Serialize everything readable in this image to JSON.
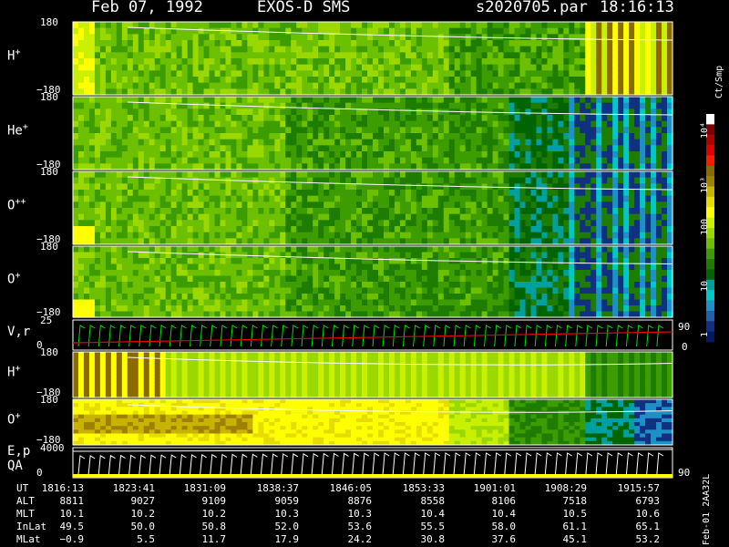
{
  "header": {
    "date": "Feb 07, 1992",
    "instrument": "EXOS-D SMS",
    "file": "s2020705.par",
    "time": "18:16:13"
  },
  "panels": [
    {
      "label_main": "H",
      "label_sup": "+",
      "top_tick": "180",
      "bottom_tick": "−180",
      "kind": "h_plus"
    },
    {
      "label_main": "He",
      "label_sup": "+",
      "top_tick": "180",
      "bottom_tick": "−180",
      "kind": "he_plus"
    },
    {
      "label_main": "O",
      "label_sup": "++",
      "top_tick": "180",
      "bottom_tick": "−180",
      "kind": "o_pp"
    },
    {
      "label_main": "O",
      "label_sup": "+",
      "top_tick": "180",
      "bottom_tick": "−180",
      "kind": "o_plus"
    },
    {
      "label_main": "V,r",
      "label_sup": "",
      "top_tick": "25",
      "bottom_tick": "0",
      "kind": "vr",
      "right_top": "90",
      "right_bottom": "0"
    },
    {
      "label_main": "H",
      "label_sup": "+",
      "top_tick": "180",
      "bottom_tick": "−180",
      "kind": "h_plus2"
    },
    {
      "label_main": "O",
      "label_sup": "+",
      "top_tick": "180",
      "bottom_tick": "−180",
      "kind": "o_plus2"
    },
    {
      "label_main": "E,p",
      "label_sub2": "QA",
      "label_sup": "",
      "top_tick": "4000",
      "bottom_tick": "0",
      "kind": "ep",
      "right_top": "90"
    }
  ],
  "colorbar": {
    "title": "Ct/Smp",
    "ticks": [
      "10⁴",
      "10³",
      "100",
      "10",
      "1"
    ],
    "colors": [
      "#ffffff",
      "#7f0000",
      "#b20000",
      "#e00000",
      "#ff1a00",
      "#8b6b00",
      "#a08000",
      "#c8b400",
      "#e6dc00",
      "#ffff00",
      "#c8f000",
      "#9ad800",
      "#6cc000",
      "#3c9c00",
      "#1e7d00",
      "#006400",
      "#00a0a0",
      "#00c8c8",
      "#1e90c8",
      "#2060b0",
      "#103080",
      "#001a60"
    ]
  },
  "chart_data": {
    "type": "heatmap",
    "title": "Feb 07, 1992   EXOS-D SMS",
    "x_axis_label": "UT",
    "ut_ticks": [
      "1816:13",
      "1823:41",
      "1831:09",
      "1838:37",
      "1846:05",
      "1853:33",
      "1901:01",
      "1908:29",
      "1915:57"
    ],
    "series_panels": [
      "H+",
      "He+",
      "O++",
      "O+",
      "V,r",
      "H+",
      "O+",
      "E,p QA"
    ],
    "pitch_angle_range": [
      -180,
      180
    ],
    "colorbar_range": [
      1,
      10000
    ],
    "colorbar_scale": "log"
  },
  "ephemeris": {
    "rows": [
      {
        "name": "UT",
        "values": [
          "1816:13",
          "1823:41",
          "1831:09",
          "1838:37",
          "1846:05",
          "1853:33",
          "1901:01",
          "1908:29",
          "1915:57"
        ]
      },
      {
        "name": "ALT",
        "values": [
          "8811",
          "9027",
          "9109",
          "9059",
          "8876",
          "8558",
          "8106",
          "7518",
          "6793"
        ]
      },
      {
        "name": "MLT",
        "values": [
          "10.1",
          "10.2",
          "10.2",
          "10.3",
          "10.3",
          "10.4",
          "10.4",
          "10.5",
          "10.6"
        ]
      },
      {
        "name": "InLat",
        "values": [
          "49.5",
          "50.0",
          "50.8",
          "52.0",
          "53.6",
          "55.5",
          "58.0",
          "61.1",
          "65.1"
        ]
      },
      {
        "name": "MLat",
        "values": [
          "−0.9",
          "5.5",
          "11.7",
          "17.9",
          "24.2",
          "30.8",
          "37.6",
          "45.1",
          "53.2"
        ]
      }
    ]
  },
  "footer_id": "Feb-01 2AA32L"
}
